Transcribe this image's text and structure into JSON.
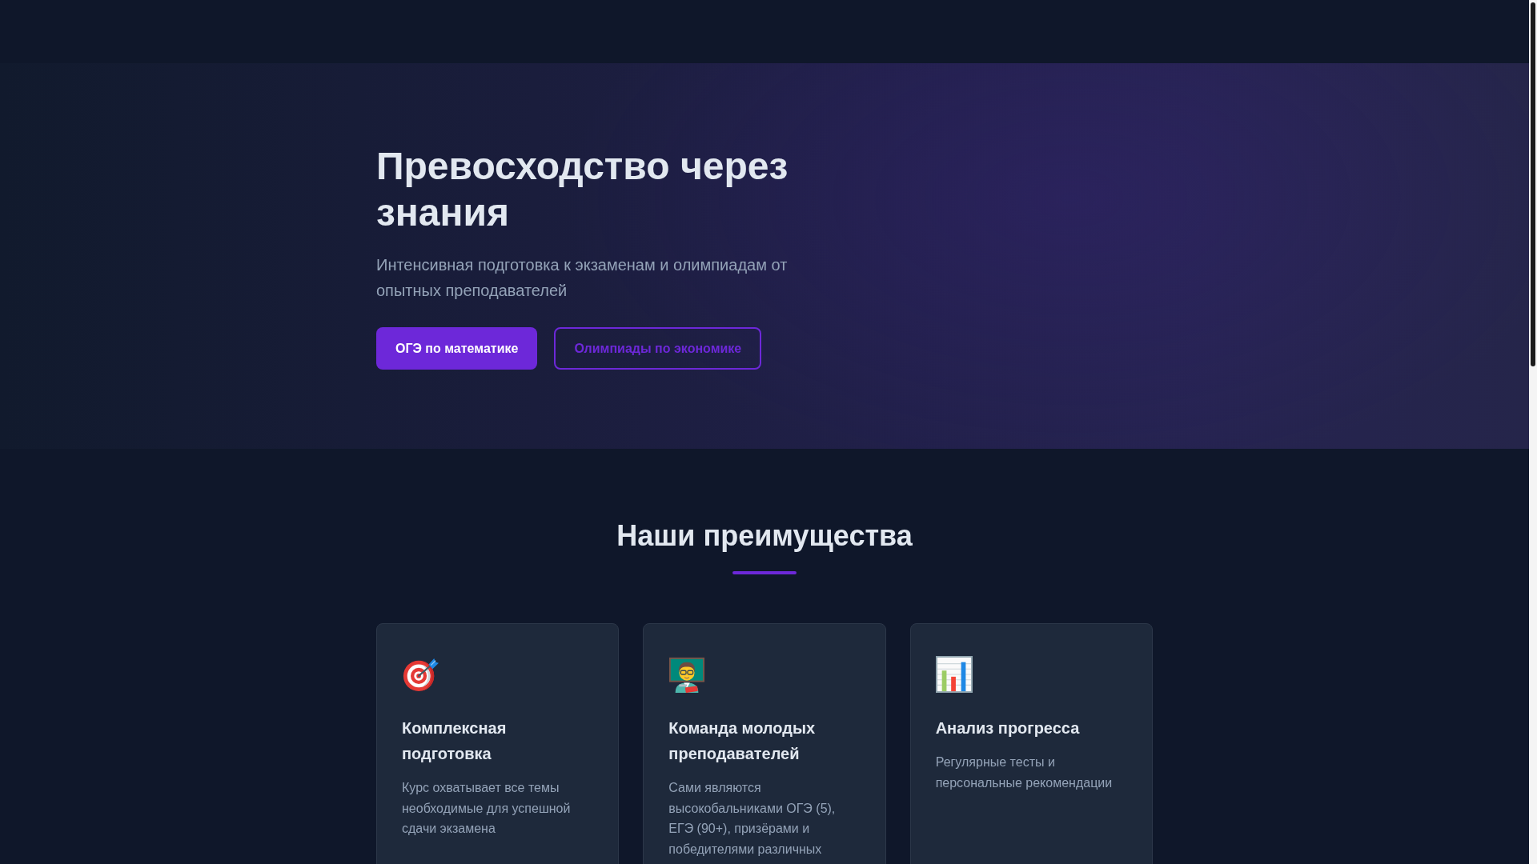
{
  "hero": {
    "title": "Превосходство через знания",
    "subtitle": "Интенсивная подготовка к экзаменам и олимпиадам от опытных преподавателей",
    "buttons": [
      {
        "label": "ОГЭ по математике",
        "kind": "primary"
      },
      {
        "label": "Олимпиады по экономике",
        "kind": "outline"
      }
    ]
  },
  "features": {
    "title": "Наши преимущества",
    "cards": [
      {
        "title": "Комплексная подготовка",
        "text": "Курс охватывает все темы необходимые для успешной сдачи экзамена"
      },
      {
        "title": "Команда молодых преподавателей",
        "text": "Сами являются высокобальниками ОГЭ (5), ЕГЭ (90+), призёрами и победителями различных"
      },
      {
        "title": "Анализ прогресса",
        "text": "Регулярные тесты и персональные рекомендации"
      }
    ]
  }
}
